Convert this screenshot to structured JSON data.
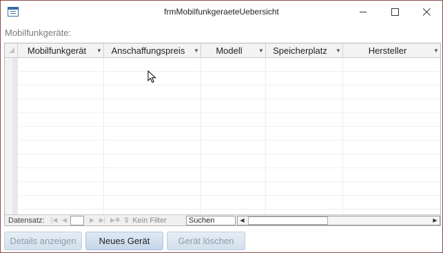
{
  "window": {
    "title": "frmMobilfunkgeraeteUebersicht",
    "controls": [
      "minimize-icon",
      "maximize-icon",
      "close-icon"
    ]
  },
  "form": {
    "label": "Mobilfunkgeräte:"
  },
  "grid": {
    "columns": [
      {
        "label": "Mobilfunkgerät"
      },
      {
        "label": "Anschaffungspreis"
      },
      {
        "label": "Modell"
      },
      {
        "label": "Speicherplatz"
      },
      {
        "label": "Hersteller"
      }
    ],
    "rows": []
  },
  "navigation": {
    "record_label": "Datensatz:",
    "record_value": "",
    "filter_label": "Kein Filter",
    "search_label": "Suchen"
  },
  "buttons": {
    "details": "Details anzeigen",
    "new": "Neues Gerät",
    "delete": "Gerät löschen"
  },
  "colors": {
    "window_border": "#8a4a4a",
    "button_fill": "#c6d7e9",
    "disabled_text": "#8d9bab"
  }
}
